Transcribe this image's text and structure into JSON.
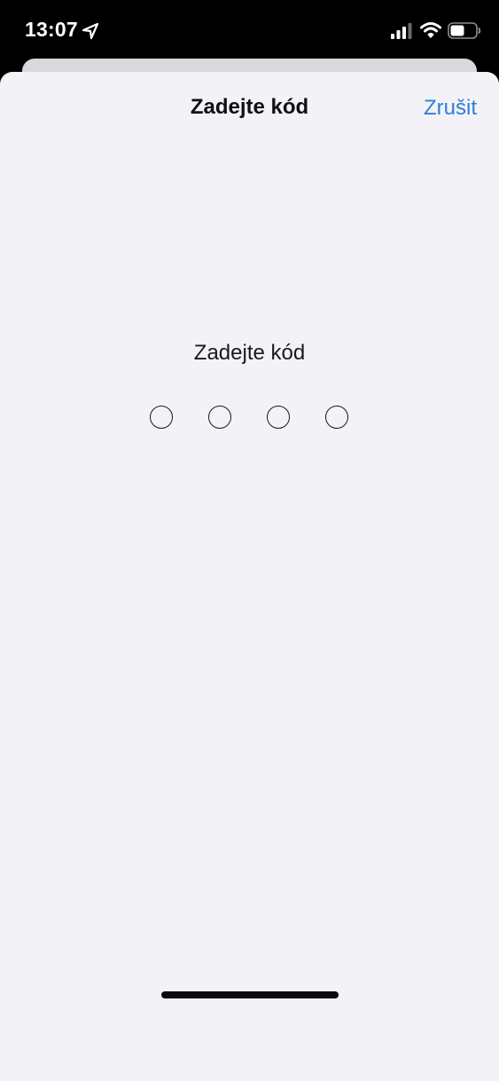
{
  "status_bar": {
    "time": "13:07",
    "icons": [
      "location-arrow-icon",
      "cellular-signal-icon",
      "wifi-icon",
      "battery-icon"
    ]
  },
  "sheet": {
    "title": "Zadejte kód",
    "cancel_label": "Zrušit",
    "prompt": "Zadejte kód",
    "code_length": 4,
    "entered_digits": 0
  },
  "colors": {
    "accent": "#2f7ddb",
    "sheet_background": "#f2f2f7",
    "status_bar_background": "#000000"
  }
}
